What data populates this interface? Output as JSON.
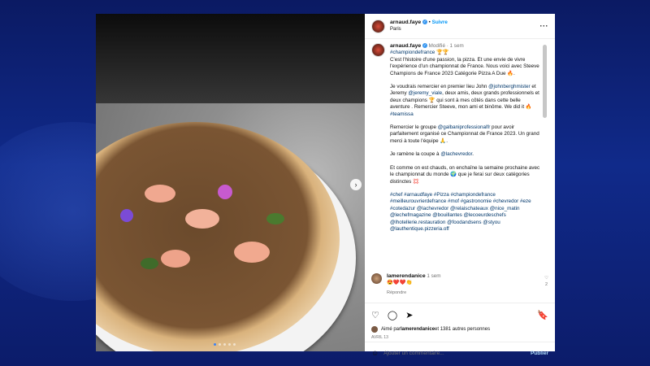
{
  "post": {
    "username": "arnaud.faye",
    "verified_glyph": "✓",
    "separator": "•",
    "follow_label": "Suivre",
    "location": "Paris",
    "more_glyph": "···"
  },
  "caption": {
    "username": "arnaud.faye",
    "meta": "Modifié · 1 sem",
    "hashtag_top": "#championdefrance 🏆🏆",
    "para1": "C'est l'histoire d'une passion, la pizza. Et une envie de vivre l'expérience d'un championnat de France. Nous voici avec Steeve Champions de France 2023 Catégorie Pizza A Due 🔥.",
    "para2_a": "Je voudrais remercier en premier lieu John ",
    "para2_link1": "@johnberghmister",
    "para2_b": " et Jeremy ",
    "para2_link2": "@jeremy_viale",
    "para2_c": ", deux amis, deux grands professionnels et deux champions 🏆 qui sont à mes côtés dans cette belle aventure . Remercier Steeve, mon ami et binôme. We did it 🔥 ",
    "para2_link3": "#teamissa",
    "para3_a": "Remercier le groupe ",
    "para3_link": "@galbaniprofessionalfr",
    "para3_b": " pour avoir parfaitement organisé ce Championnat de France 2023. Un grand merci à toute l'équipe 🙏.",
    "para4_a": "Je ramène la coupe à ",
    "para4_link": "@lachevredor",
    "para4_b": ".",
    "para5": "Et comme on est chauds, on enchaîne la semaine prochaine avec le championnat du monde 🌍 que je ferai sur deux catégories distinctes 💢",
    "hashtags": "#chef #arnaudfaye #Pizza #championdefrance #meilleurouvrierdefrance #mof #gastronomie #chevredor #eze #cotedazur @lachevredor @relaischateaux @nice_matin @lechefmagazine @bouillantes @lecoeurdeschefs @lhotellerie.restauration @foodandsens @styou @lauthentique.pizzeria.off"
  },
  "comment": {
    "username": "lamerendanice",
    "time": "1 sem",
    "text": "😍❤️❤️👏",
    "reply_label": "Répondre",
    "like_glyph": "♡",
    "like_count": "2"
  },
  "actions": {
    "like_glyph": "♡",
    "comment_glyph": "◯",
    "share_glyph": "➤",
    "save_glyph": "🔖"
  },
  "likes": {
    "prefix": "Aimé par ",
    "user": "lamerendanice",
    "suffix": " et 1381 autres personnes"
  },
  "date": "AVRIL 13",
  "add_comment": {
    "emoji_glyph": "☺",
    "placeholder": "Ajouter un commentaire...",
    "publish_label": "Publier"
  },
  "carousel": {
    "next_glyph": "›",
    "dots_total": 5,
    "active_index": 0
  }
}
